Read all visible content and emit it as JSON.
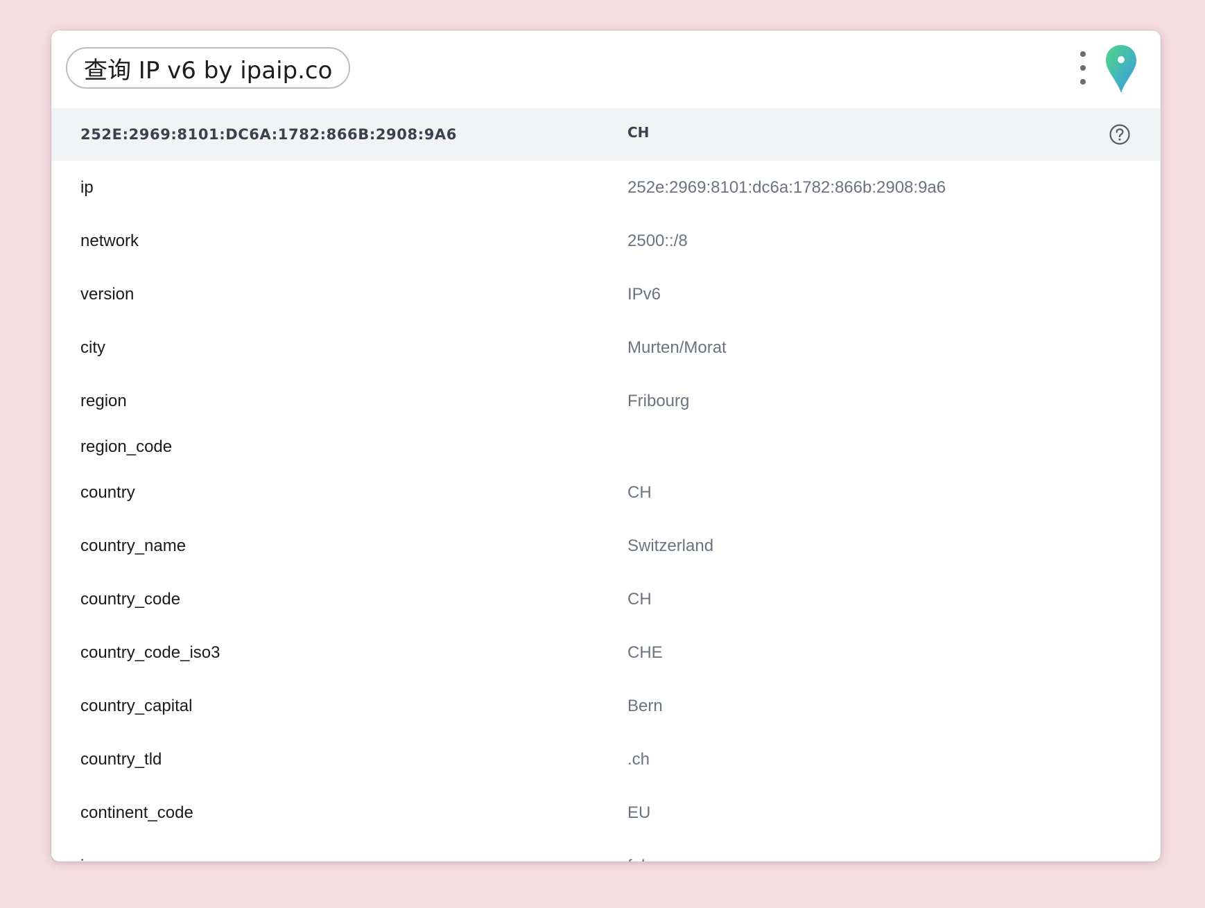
{
  "header": {
    "title": "查询 IP v6 by ipaip.co",
    "menu_icon": "more-vertical-icon",
    "logo_icon": "map-pin-icon"
  },
  "summary": {
    "ip": "252E:2969:8101:DC6A:1782:866B:2908:9A6",
    "country": "CH",
    "help_icon": "question-circle-icon"
  },
  "rows": [
    {
      "key": "ip",
      "value": "252e:2969:8101:dc6a:1782:866b:2908:9a6"
    },
    {
      "key": "network",
      "value": "2500::/8"
    },
    {
      "key": "version",
      "value": "IPv6"
    },
    {
      "key": "city",
      "value": "Murten/Morat"
    },
    {
      "key": "region",
      "value": "Fribourg"
    },
    {
      "key": "region_code",
      "value": ""
    },
    {
      "key": "country",
      "value": "CH"
    },
    {
      "key": "country_name",
      "value": "Switzerland"
    },
    {
      "key": "country_code",
      "value": "CH"
    },
    {
      "key": "country_code_iso3",
      "value": "CHE"
    },
    {
      "key": "country_capital",
      "value": "Bern"
    },
    {
      "key": "country_tld",
      "value": ".ch"
    },
    {
      "key": "continent_code",
      "value": "EU"
    },
    {
      "key": "in_eu",
      "value": "false"
    }
  ],
  "colors": {
    "background": "#f6dde2",
    "summary_bg": "#f2f3f5",
    "pin_gradient_start": "#3ecf8e",
    "pin_gradient_end": "#3b9be8"
  }
}
